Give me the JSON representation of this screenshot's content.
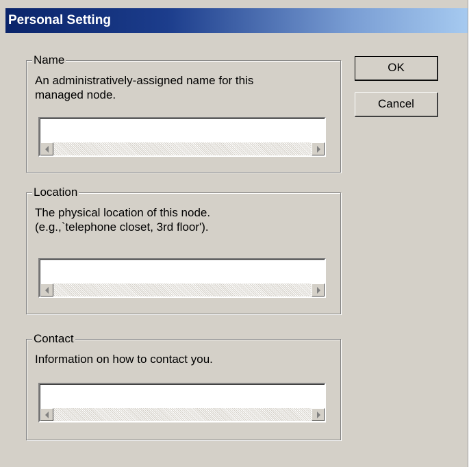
{
  "dialog": {
    "title": "Personal Setting"
  },
  "groups": {
    "name": {
      "legend": "Name",
      "description": "An administratively-assigned name for this\nmanaged node.",
      "value": ""
    },
    "location": {
      "legend": "Location",
      "description": "The physical location of this node.\n(e.g.,`telephone closet, 3rd floor').",
      "value": ""
    },
    "contact": {
      "legend": "Contact",
      "description": "Information on how to contact you.",
      "value": ""
    }
  },
  "buttons": {
    "ok_label": "OK",
    "cancel_label": "Cancel"
  },
  "icons": {
    "scroll_left": "scroll-left-arrow-icon",
    "scroll_right": "scroll-right-arrow-icon"
  },
  "colors": {
    "dialog_bg": "#d4d0c8",
    "title_start": "#0a246a",
    "title_end": "#a6caf0"
  }
}
